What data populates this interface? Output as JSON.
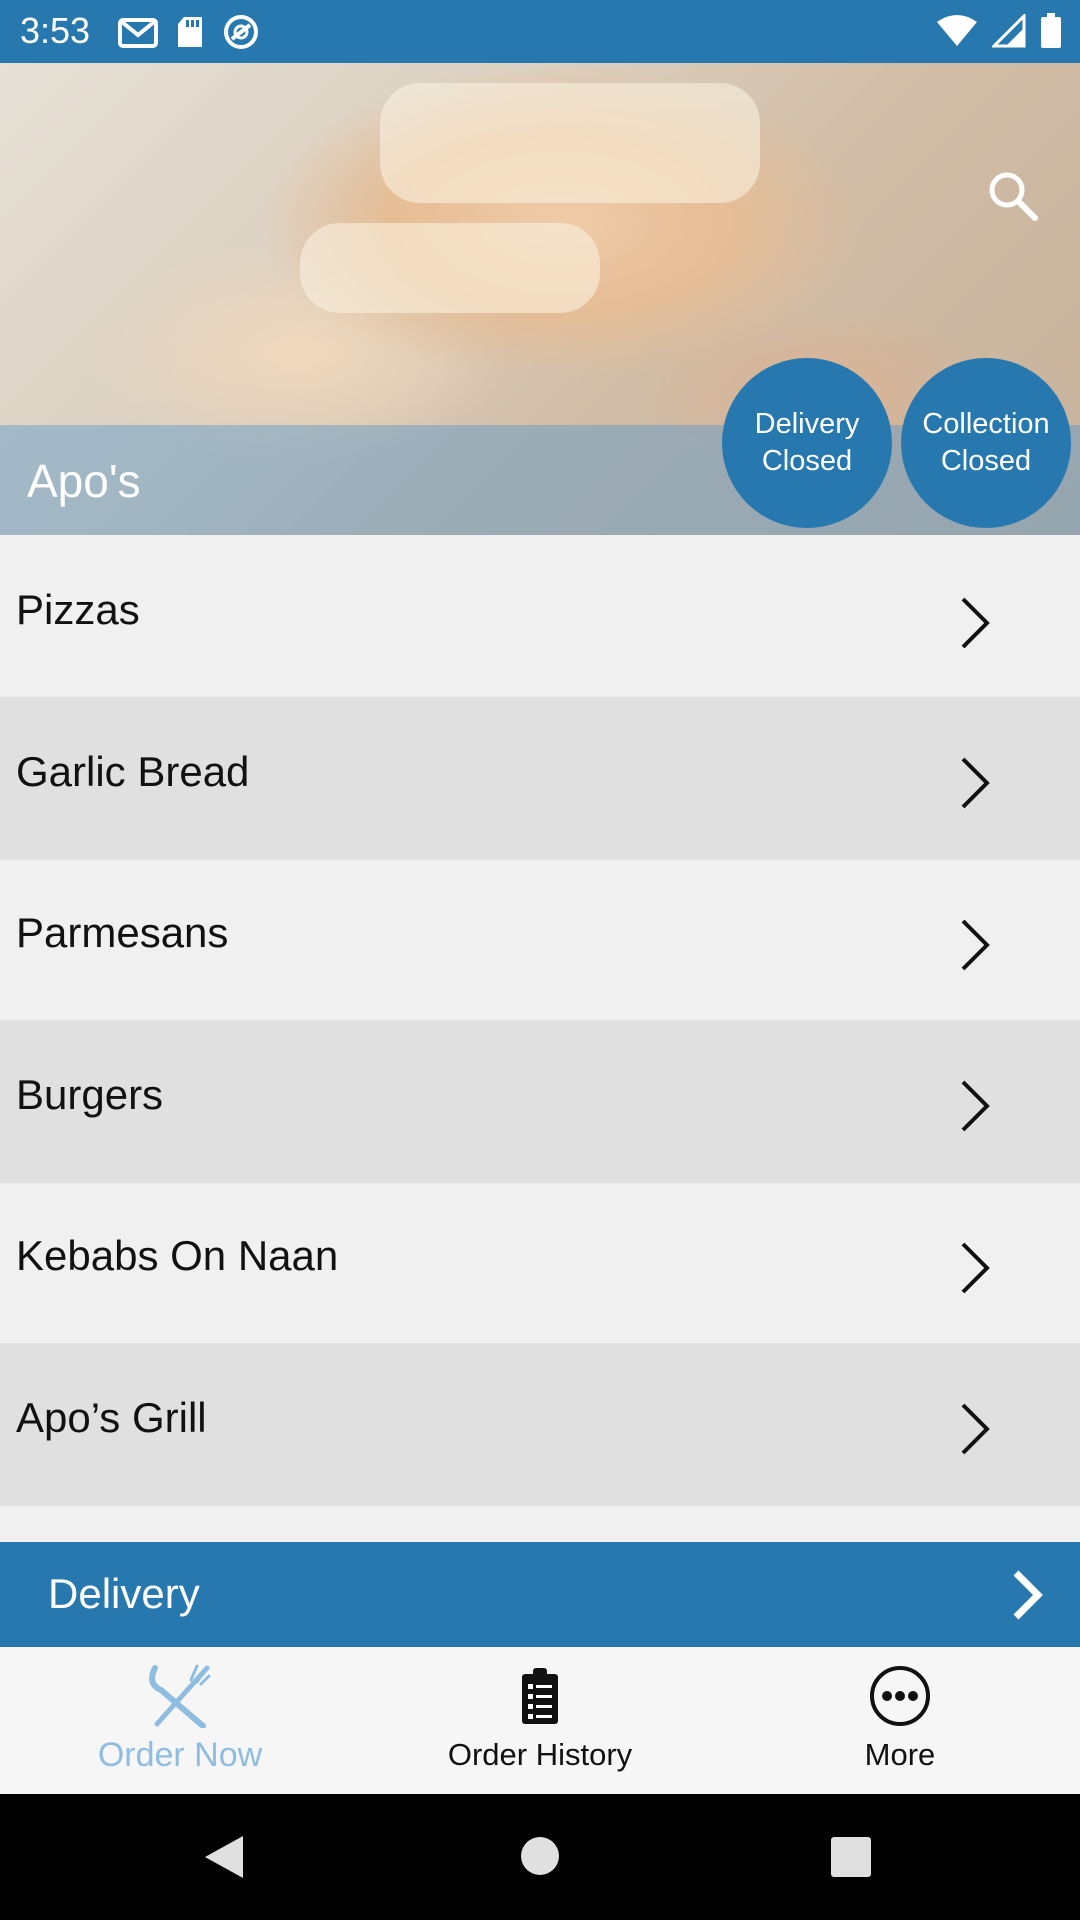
{
  "status_bar": {
    "time": "3:53",
    "left_icons": [
      "gmail-icon",
      "sd-card-icon",
      "vpn-icon"
    ],
    "right_icons": [
      "wifi-icon",
      "signal-icon",
      "battery-icon"
    ]
  },
  "header": {
    "restaurant_name": "Apo's",
    "search_icon": "search-icon",
    "delivery_status": {
      "line1": "Delivery",
      "line2": "Closed"
    },
    "collection_status": {
      "line1": "Collection",
      "line2": "Closed"
    }
  },
  "menu": {
    "items": [
      {
        "label": "Pizzas"
      },
      {
        "label": "Garlic Bread"
      },
      {
        "label": "Parmesans"
      },
      {
        "label": "Burgers"
      },
      {
        "label": "Kebabs On Naan"
      },
      {
        "label": "Apo’s Grill"
      }
    ]
  },
  "delivery_bar": {
    "label": "Delivery"
  },
  "bottom_nav": {
    "items": [
      {
        "label": "Order Now",
        "icon": "fork-knife-icon",
        "active": true
      },
      {
        "label": "Order History",
        "icon": "clipboard-icon",
        "active": false
      },
      {
        "label": "More",
        "icon": "more-icon",
        "active": false
      }
    ]
  },
  "colors": {
    "primary": "#2878b0",
    "active_nav": "#8fbde0",
    "row_light": "#f0f0f0",
    "row_dark": "#e0e0e0"
  }
}
